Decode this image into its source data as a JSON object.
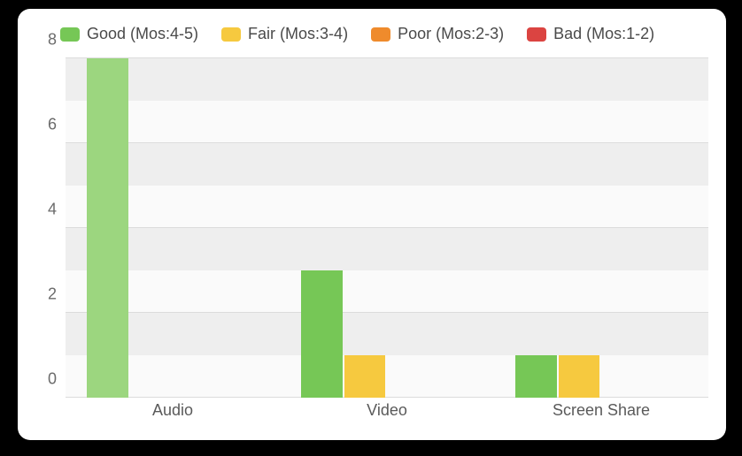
{
  "legend": {
    "items": [
      {
        "label": "Good (Mos:4-5)",
        "color": "#76c756"
      },
      {
        "label": "Fair (Mos:3-4)",
        "color": "#f6c93f"
      },
      {
        "label": "Poor (Mos:2-3)",
        "color": "#ef8b2c"
      },
      {
        "label": "Bad (Mos:1-2)",
        "color": "#db4441"
      }
    ]
  },
  "axes": {
    "y_ticks": [
      "0",
      "2",
      "4",
      "6",
      "8"
    ]
  },
  "chart_data": {
    "type": "bar",
    "categories": [
      "Audio",
      "Video",
      "Screen Share"
    ],
    "series": [
      {
        "name": "Good (Mos:4-5)",
        "color": "#76c756",
        "values": [
          8,
          3,
          1
        ]
      },
      {
        "name": "Fair (Mos:3-4)",
        "color": "#f6c93f",
        "values": [
          0,
          1,
          1
        ]
      },
      {
        "name": "Poor (Mos:2-3)",
        "color": "#ef8b2c",
        "values": [
          0,
          0,
          0
        ]
      },
      {
        "name": "Bad (Mos:1-2)",
        "color": "#db4441",
        "values": [
          0,
          0,
          0
        ]
      }
    ],
    "ylim": [
      0,
      8
    ],
    "xlabel": "",
    "ylabel": "",
    "title": "",
    "note": "Audio/Good bar is rendered in a lighter green (hover/highlight state) in the source image.",
    "highlight": {
      "category_index": 0,
      "series_index": 0,
      "color": "#9cd67f"
    }
  }
}
